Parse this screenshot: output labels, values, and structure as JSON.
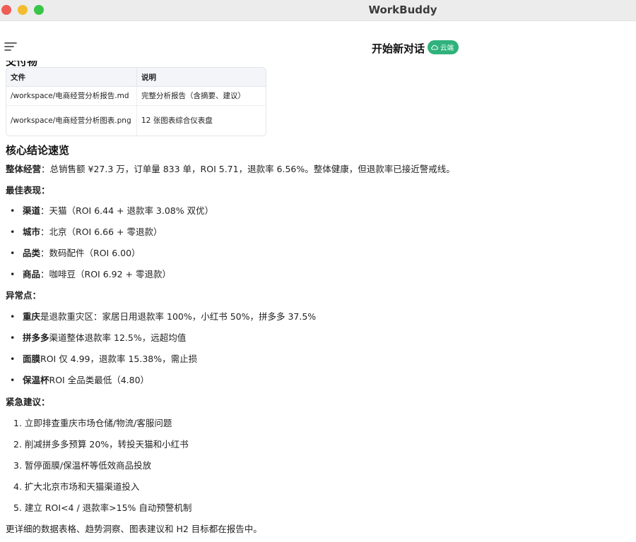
{
  "window": {
    "title": "WorkBuddy"
  },
  "header": {
    "chat_title": "开始新对话",
    "badge_label": "云端",
    "badge_color": "#2fb27b"
  },
  "artifacts": {
    "heading": "交付物",
    "columns": [
      "文件",
      "说明"
    ],
    "rows": [
      {
        "file": "/workspace/电商经营分析报告.md",
        "desc": "完整分析报告（含摘要、建议）"
      },
      {
        "file": "/workspace/电商经营分析图表.png",
        "desc": "12 张图表综合仪表盘"
      }
    ]
  },
  "summary": {
    "heading": "核心结论速览",
    "overall_label": "整体经营",
    "overall_text": "：总销售额 ¥27.3 万，订单量 833 单，ROI 5.71，退款率 6.56%。整体健康，但退款率已接近警戒线。",
    "best_heading": "最佳表现：",
    "best": [
      {
        "label": "渠道",
        "text": "：天猫（ROI 6.44 + 退款率 3.08% 双优）"
      },
      {
        "label": "城市",
        "text": "：北京（ROI 6.66 + 零退款）"
      },
      {
        "label": "品类",
        "text": "：数码配件（ROI 6.00）"
      },
      {
        "label": "商品",
        "text": "：咖啡豆（ROI 6.92 + 零退款）"
      }
    ],
    "anomaly_heading": "异常点：",
    "anomalies": [
      {
        "label": "重庆",
        "text": "是退款重灾区：家居日用退款率 100%，小红书 50%，拼多多 37.5%"
      },
      {
        "label": "拼多多",
        "text": "渠道整体退款率 12.5%，远超均值"
      },
      {
        "label": "面膜",
        "text": "ROI 仅 4.99，退款率 15.38%，需止损"
      },
      {
        "label": "保温杯",
        "text": "ROI 全品类最低（4.80）"
      }
    ],
    "urgent_heading": "紧急建议：",
    "urgent": [
      "1. 立即排查重庆市场仓储/物流/客服问题",
      "2. 削减拼多多预算 20%，转投天猫和小红书",
      "3. 暂停面膜/保温杯等低效商品投放",
      "4. 扩大北京市场和天猫渠道投入",
      "5. 建立 ROI<4 / 退款率>15% 自动预警机制"
    ],
    "footer": "更详细的数据表格、趋势洞察、图表建议和 H2 目标都在报告中。"
  }
}
